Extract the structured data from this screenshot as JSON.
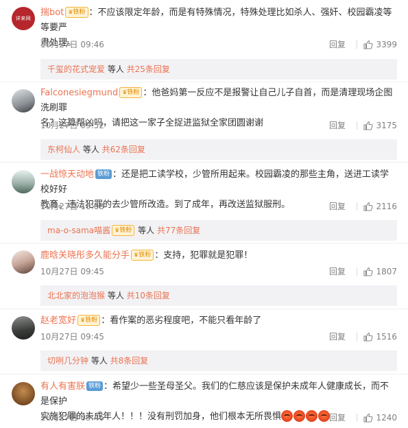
{
  "comments": [
    {
      "avatar": {
        "kind": "logo",
        "text": "详来网"
      },
      "username": "揣bot",
      "badge": "铁粉",
      "content_lines": [
        "：不应该限定年龄，而是有特殊情况，特殊处理比如杀人、强奸、校园霸凌等等要严",
        "肃处理。"
      ],
      "time": "10月27日 09:46",
      "reply_label": "回复",
      "likes": "3399",
      "thread": {
        "user": "千玺的花式宠爱",
        "middle": " 等人 ",
        "link": "共25条回复"
      }
    },
    {
      "avatar": {
        "kind": "photo"
      },
      "username": "Falconesiegmund",
      "badge": "铁粉",
      "content_lines": [
        "：他爸妈第一反应不是报警让自己儿子自首，而是清理现场企图洗刷罪",
        "名？这算帮凶吗，请把这一家子全捉进监狱全家团圆谢谢"
      ],
      "time": "10月27日 09:52",
      "reply_label": "回复",
      "likes": "3175",
      "thread": {
        "user": "东柯仙人",
        "middle": " 等人 ",
        "link": "共62条回复"
      }
    },
    {
      "avatar": {
        "kind": "photo"
      },
      "username": "一战惊天动地",
      "badge": "铁粉",
      "content_lines": [
        "：还是把工读学校，少管所用起来。校园霸凌的那些主角，送进工读学校好好",
        "教育。违法犯罪的去少管所改造。到了成年，再改送监狱服刑。"
      ],
      "time": "10月27日 10:08",
      "reply_label": "回复",
      "likes": "2116",
      "thread": {
        "user": "ma-o-sama喵酱",
        "middle": " 等人 ",
        "link": "共77条回复"
      }
    },
    {
      "avatar": {
        "kind": "photo"
      },
      "username": "鹿晗关晓彤多久能分手",
      "badge": "铁粉",
      "content_lines": [
        "：支持，犯罪就是犯罪！"
      ],
      "time": "10月27日 09:45",
      "reply_label": "回复",
      "likes": "1807",
      "thread": {
        "user": "北北家的泡泡猴",
        "middle": " 等人 ",
        "link": "共10条回复"
      }
    },
    {
      "avatar": {
        "kind": "photo"
      },
      "username": "赵老宽好",
      "badge": "铁粉",
      "content_lines": [
        "：看作案的恶劣程度吧，不能只看年龄了"
      ],
      "time": "10月27日 09:45",
      "reply_label": "回复",
      "likes": "1516",
      "thread": {
        "user": "切咧几分钟",
        "middle": " 等人 ",
        "link": "共8条回复"
      }
    },
    {
      "avatar": {
        "kind": "photo"
      },
      "username": "有人有害朕",
      "badge": "铁粉",
      "content_lines": [
        "：希望少一些圣母圣父。我们的仁慈应该是保护未成年人健康成长，而不是保护",
        "实施犯罪的未成年人！！！没有刑罚加身，他们根本无所畏惧"
      ],
      "time": "10月27日 09:46",
      "reply_label": "回复",
      "likes": "1240"
    }
  ],
  "colors": {
    "username": "#eb7350",
    "text": "#333333",
    "meta": "#808080",
    "thread_bg": "#f2f2f5"
  },
  "icons": {
    "like": "thumbs-up-icon",
    "emoji": "angry-face-icon"
  }
}
